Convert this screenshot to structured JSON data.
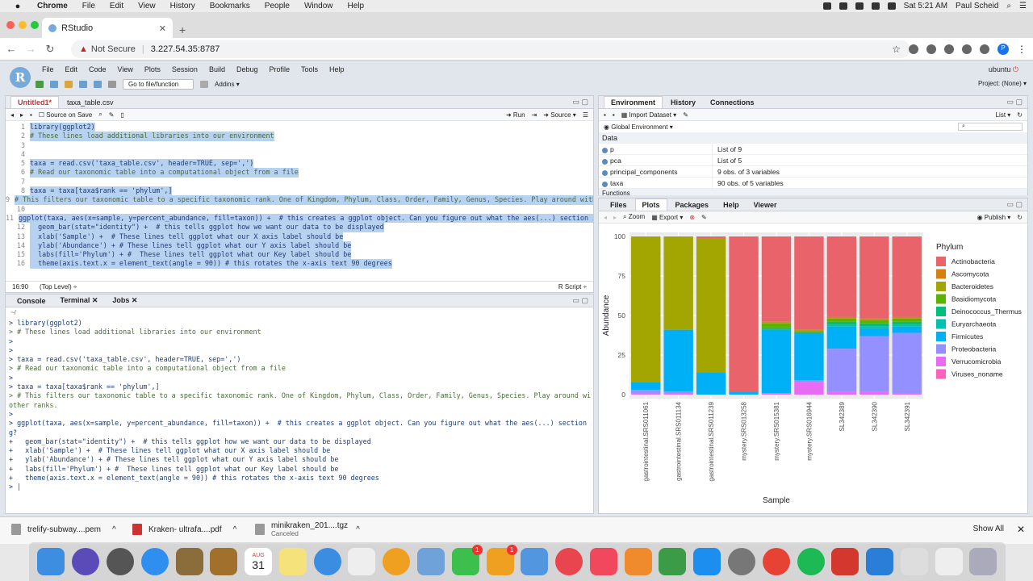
{
  "menubar": {
    "app": "Chrome",
    "items": [
      "File",
      "Edit",
      "View",
      "History",
      "Bookmarks",
      "People",
      "Window",
      "Help"
    ],
    "clock": "Sat 5:21 AM",
    "user": "Paul Scheid"
  },
  "browser": {
    "tab_title": "RStudio",
    "not_secure": "Not Secure",
    "url": "3.227.54.35:8787",
    "profile_initial": "P"
  },
  "rstudio": {
    "menu": [
      "File",
      "Edit",
      "Code",
      "View",
      "Plots",
      "Session",
      "Build",
      "Debug",
      "Profile",
      "Tools",
      "Help"
    ],
    "user": "ubuntu",
    "goto_file": "Go to file/function",
    "addins": "Addins",
    "project": "Project: (None)"
  },
  "source": {
    "tabs": [
      "Untitled1*",
      "taxa_table.csv"
    ],
    "source_on_save": "Source on Save",
    "run": "Run",
    "source_btn": "Source",
    "lines": [
      {
        "n": "1",
        "t": "library(ggplot2)",
        "c": false
      },
      {
        "n": "2",
        "t": "# These lines load additional libraries into our environment",
        "c": true
      },
      {
        "n": "3",
        "t": "",
        "c": false
      },
      {
        "n": "4",
        "t": "",
        "c": false
      },
      {
        "n": "5",
        "t": "taxa = read.csv('taxa_table.csv', header=TRUE, sep=',')",
        "c": false
      },
      {
        "n": "6",
        "t": "# Read our taxonomic table into a computational object from a file",
        "c": true
      },
      {
        "n": "7",
        "t": "",
        "c": false
      },
      {
        "n": "8",
        "t": "taxa = taxa[taxa$rank == 'phylum',]",
        "c": false
      },
      {
        "n": "9",
        "t": "# This filters our taxonomic table to a specific taxonomic rank. One of Kingdom, Phylum, Class, Order, Family, Genus, Species. Play around with a",
        "c": true
      },
      {
        "n": "10",
        "t": "",
        "c": false
      },
      {
        "n": "11",
        "t": "ggplot(taxa, aes(x=sample, y=percent_abundance, fill=taxon)) +  # this creates a ggplot object. Can you figure out what the aes(...) section is d",
        "c": false
      },
      {
        "n": "12",
        "t": "  geom_bar(stat=\"identity\") +  # this tells ggplot how we want our data to be displayed",
        "c": false
      },
      {
        "n": "13",
        "t": "  xlab('Sample') +  # These lines tell ggplot what our X axis label should be",
        "c": false
      },
      {
        "n": "14",
        "t": "  ylab('Abundance') + # These lines tell ggplot what our Y axis label should be",
        "c": false
      },
      {
        "n": "15",
        "t": "  labs(fill='Phylum') + #  These lines tell ggplot what our Key label should be",
        "c": false
      },
      {
        "n": "16",
        "t": "  theme(axis.text.x = element_text(angle = 90)) # this rotates the x-axis text 90 degrees",
        "c": false
      }
    ],
    "cursor_pos": "16:90",
    "scope": "(Top Level)",
    "file_type": "R Script"
  },
  "console": {
    "tabs": [
      "Console",
      "Terminal",
      "Jobs"
    ],
    "path": "~/",
    "lines": [
      {
        "t": "> library(ggplot2)",
        "c": false
      },
      {
        "t": "> # These lines load additional libraries into our environment",
        "c": true
      },
      {
        "t": ">",
        "c": false
      },
      {
        "t": ">",
        "c": false
      },
      {
        "t": "> taxa = read.csv('taxa_table.csv', header=TRUE, sep=',')",
        "c": false
      },
      {
        "t": "> # Read our taxonomic table into a computational object from a file",
        "c": true
      },
      {
        "t": ">",
        "c": false
      },
      {
        "t": "> taxa = taxa[taxa$rank == 'phylum',]",
        "c": false
      },
      {
        "t": "> # This filters our taxonomic table to a specific taxonomic rank. One of Kingdom, Phylum, Class, Order, Family, Genus, Species. Play around with a few",
        "c": true
      },
      {
        "t": "other ranks.",
        "c": true
      },
      {
        "t": ">",
        "c": false
      },
      {
        "t": "> ggplot(taxa, aes(x=sample, y=percent_abundance, fill=taxon)) +  # this creates a ggplot object. Can you figure out what the aes(...) section is doin",
        "c": false
      },
      {
        "t": "g?",
        "c": false
      },
      {
        "t": "+   geom_bar(stat=\"identity\") +  # this tells ggplot how we want our data to be displayed",
        "c": false
      },
      {
        "t": "+   xlab('Sample') +  # These lines tell ggplot what our X axis label should be",
        "c": false
      },
      {
        "t": "+   ylab('Abundance') + # These lines tell ggplot what our Y axis label should be",
        "c": false
      },
      {
        "t": "+   labs(fill='Phylum') + #  These lines tell ggplot what our Key label should be",
        "c": false
      },
      {
        "t": "+   theme(axis.text.x = element_text(angle = 90)) # this rotates the x-axis text 90 degrees",
        "c": false
      },
      {
        "t": "> |",
        "c": false
      }
    ]
  },
  "environment": {
    "tabs": [
      "Environment",
      "History",
      "Connections"
    ],
    "import": "Import Dataset",
    "list_mode": "List",
    "scope": "Global Environment",
    "section": "Data",
    "rows": [
      {
        "name": "p",
        "value": "List of 9"
      },
      {
        "name": "pca",
        "value": "List of 5"
      },
      {
        "name": "principal_components",
        "value": "9 obs. of 3 variables"
      },
      {
        "name": "taxa",
        "value": "90 obs. of 5 variables"
      }
    ],
    "next_section": "Functions"
  },
  "plots": {
    "tabs": [
      "Files",
      "Plots",
      "Packages",
      "Help",
      "Viewer"
    ],
    "zoom": "Zoom",
    "export": "Export",
    "publish": "Publish"
  },
  "chart_data": {
    "type": "bar",
    "stacked": true,
    "xlabel": "Sample",
    "ylabel": "Abundance",
    "ylim": [
      0,
      100
    ],
    "yticks": [
      0,
      25,
      50,
      75,
      100
    ],
    "legend_title": "Phylum",
    "legend_position": "right",
    "categories": [
      "gastrointestinal.SRS011061",
      "gastrointestinal.SRS011134",
      "gastrointestinal.SRS011239",
      "mystery.SRS013258",
      "mystery.SRS015381",
      "mystery.SRS016944",
      "SL342389",
      "SL342390",
      "SL342391"
    ],
    "series": [
      {
        "name": "Actinobacteria",
        "color": "#e8636a",
        "values": [
          0,
          0,
          1,
          98,
          54,
          59,
          51,
          52,
          51
        ]
      },
      {
        "name": "Ascomycota",
        "color": "#d4820f",
        "values": [
          0,
          0,
          0,
          0,
          0,
          0,
          0,
          0,
          0
        ]
      },
      {
        "name": "Bacteroidetes",
        "color": "#a3a500",
        "values": [
          92,
          59,
          85,
          0,
          1,
          1,
          1,
          1,
          1
        ]
      },
      {
        "name": "Basidiomycota",
        "color": "#5bb300",
        "values": [
          0,
          0,
          0,
          0,
          3,
          1,
          2,
          2,
          2
        ]
      },
      {
        "name": "Deinococcus_Thermus",
        "color": "#00bf7d",
        "values": [
          0,
          0,
          0,
          0,
          1,
          0,
          2,
          2,
          2
        ]
      },
      {
        "name": "Euryarchaeota",
        "color": "#00c0af",
        "values": [
          0,
          0,
          0,
          0,
          0,
          0,
          1,
          1,
          1
        ]
      },
      {
        "name": "Firmicutes",
        "color": "#00b0f6",
        "values": [
          5,
          39,
          14,
          2,
          40,
          30,
          14,
          5,
          4
        ]
      },
      {
        "name": "Proteobacteria",
        "color": "#9590ff",
        "values": [
          2,
          1,
          0,
          0,
          0,
          1,
          27,
          35,
          38
        ]
      },
      {
        "name": "Verrucomicrobia",
        "color": "#e76bf3",
        "values": [
          1,
          1,
          0,
          0,
          1,
          8,
          2,
          2,
          1
        ]
      },
      {
        "name": "Viruses_noname",
        "color": "#ff62bc",
        "values": [
          0,
          0,
          0,
          0,
          0,
          0,
          0,
          0,
          0
        ]
      }
    ]
  },
  "downloads": {
    "items": [
      {
        "name": "trelify-subway....pem",
        "sub": ""
      },
      {
        "name": "Kraken- ultrafa....pdf",
        "sub": ""
      },
      {
        "name": "minikraken_201....tgz",
        "sub": "Canceled"
      }
    ],
    "show_all": "Show All"
  },
  "dock": {
    "calendar_month": "AUG",
    "calendar_day": "31",
    "badges": [
      "1",
      "1"
    ]
  }
}
